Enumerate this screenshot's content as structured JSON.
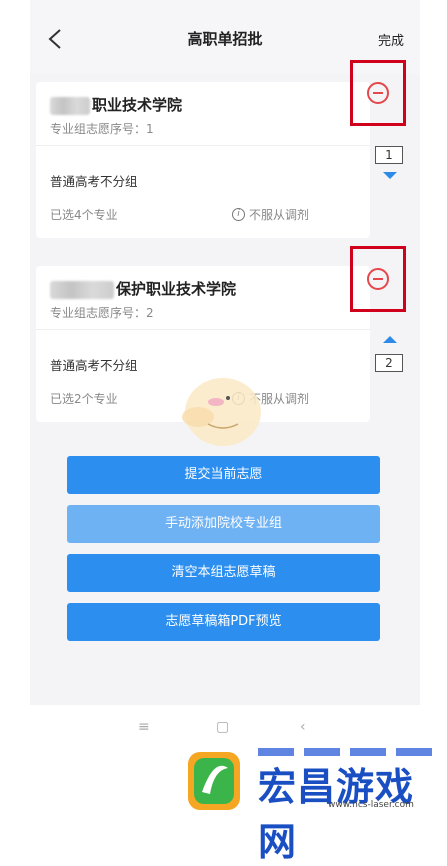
{
  "header": {
    "title": "高职单招批",
    "done_label": "完成"
  },
  "cards": [
    {
      "school_suffix": "职业技术学院",
      "seq_label": "专业组志愿序号：1",
      "group": "普通高考不分组",
      "selected": "已选4个专业",
      "no_adjust": "不服从调剂",
      "rank": "1"
    },
    {
      "school_suffix": "保护职业技术学院",
      "seq_label": "专业组志愿序号：2",
      "group": "普通高考不分组",
      "selected": "已选2个专业",
      "no_adjust": "不服从调剂",
      "rank": "2"
    }
  ],
  "buttons": {
    "submit": "提交当前志愿",
    "add_group": "手动添加院校专业组",
    "clear_draft": "清空本组志愿草稿",
    "pdf_preview": "志愿草稿箱PDF预览"
  },
  "navbar": {
    "menu": "≡",
    "home": "▢",
    "back": "‹"
  },
  "watermark": {
    "brand": "宏昌游戏网",
    "url": "www.hcs-laser.com"
  },
  "colors": {
    "accent": "#2c8ff0",
    "remove_red": "#e5474b",
    "highlight_border": "#d0021b"
  }
}
